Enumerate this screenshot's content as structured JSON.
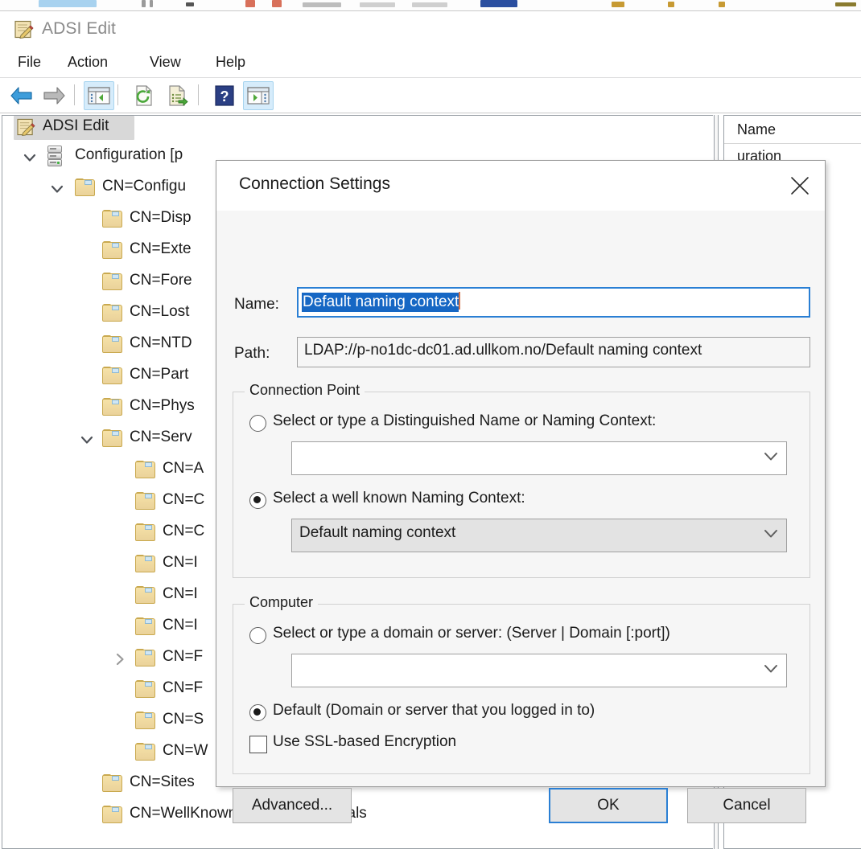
{
  "window": {
    "title": "ADSI Edit",
    "title_icon": "adsi-edit-icon",
    "menu": [
      {
        "label": "File"
      },
      {
        "label": "Action"
      },
      {
        "label": "View"
      },
      {
        "label": "Help"
      }
    ],
    "toolbar": [
      {
        "name": "back-icon",
        "active": false
      },
      {
        "name": "forward-icon",
        "active": false
      },
      {
        "name": "show-hide-console-tree-icon",
        "active": true
      },
      {
        "name": "refresh-icon",
        "active": false
      },
      {
        "name": "export-list-icon",
        "active": false
      },
      {
        "name": "help-icon",
        "active": false
      },
      {
        "name": "show-hide-action-pane-icon",
        "active": true
      }
    ]
  },
  "tree": {
    "root_label": "ADSI Edit",
    "root_icon": "adsi-edit-icon",
    "items": [
      {
        "label": "Configuration [p",
        "icon": "server-icon",
        "depth": 0,
        "expander": "expanded"
      },
      {
        "label": "CN=Configu",
        "icon": "folder-icon",
        "depth": 1,
        "expander": "expanded"
      },
      {
        "label": "CN=Disp",
        "icon": "folder-icon",
        "depth": 2,
        "expander": "none"
      },
      {
        "label": "CN=Exte",
        "icon": "folder-icon",
        "depth": 2,
        "expander": "none"
      },
      {
        "label": "CN=Fore",
        "icon": "folder-icon",
        "depth": 2,
        "expander": "none"
      },
      {
        "label": "CN=Lost",
        "icon": "folder-icon",
        "depth": 2,
        "expander": "none"
      },
      {
        "label": "CN=NTD",
        "icon": "folder-icon",
        "depth": 2,
        "expander": "none"
      },
      {
        "label": "CN=Part",
        "icon": "folder-icon",
        "depth": 2,
        "expander": "none"
      },
      {
        "label": "CN=Phys",
        "icon": "folder-icon",
        "depth": 2,
        "expander": "none"
      },
      {
        "label": "CN=Serv",
        "icon": "folder-icon",
        "depth": 2,
        "expander": "expanded"
      },
      {
        "label": "CN=A",
        "icon": "folder-icon",
        "depth": 3,
        "expander": "none"
      },
      {
        "label": "CN=C",
        "icon": "folder-icon",
        "depth": 3,
        "expander": "none"
      },
      {
        "label": "CN=C",
        "icon": "folder-icon",
        "depth": 3,
        "expander": "none"
      },
      {
        "label": "CN=I",
        "icon": "folder-icon",
        "depth": 3,
        "expander": "none"
      },
      {
        "label": "CN=I",
        "icon": "folder-icon",
        "depth": 3,
        "expander": "none"
      },
      {
        "label": "CN=I",
        "icon": "folder-icon",
        "depth": 3,
        "expander": "none"
      },
      {
        "label": "CN=F",
        "icon": "folder-icon",
        "depth": 3,
        "expander": "collapsed"
      },
      {
        "label": "CN=F",
        "icon": "folder-icon",
        "depth": 3,
        "expander": "none"
      },
      {
        "label": "CN=S",
        "icon": "folder-icon",
        "depth": 3,
        "expander": "none"
      },
      {
        "label": "CN=W",
        "icon": "folder-icon",
        "depth": 3,
        "expander": "none"
      },
      {
        "label": "CN=Sites",
        "icon": "folder-icon",
        "depth": 2,
        "expander": "none"
      },
      {
        "label": "CN=WellKnown Security Principals",
        "icon": "folder-icon",
        "depth": 2,
        "expander": "none"
      }
    ]
  },
  "right_pane": {
    "column_header": "Name",
    "rows": [
      {
        "name": "uration"
      }
    ]
  },
  "dialog": {
    "title": "Connection Settings",
    "close_icon": "close-icon",
    "name_label": "Name:",
    "name_value": "Default naming context",
    "path_label": "Path:",
    "path_value": "LDAP://p-no1dc-dc01.ad.ullkom.no/Default naming context",
    "connection_point": {
      "legend": "Connection Point",
      "option_dn_label": "Select or type a Distinguished Name or Naming Context:",
      "option_dn_selected": false,
      "dn_combo_value": "",
      "option_wellknown_label": "Select a well known Naming Context:",
      "option_wellknown_selected": true,
      "wellknown_combo_value": "Default naming context"
    },
    "computer": {
      "legend": "Computer",
      "option_server_label": "Select or type a domain or server: (Server | Domain [:port])",
      "option_server_selected": false,
      "server_combo_value": "",
      "option_default_label": "Default (Domain or server that you logged in to)",
      "option_default_selected": true,
      "ssl_checkbox_label": "Use SSL-based Encryption",
      "ssl_checked": false
    },
    "buttons": {
      "advanced": "Advanced...",
      "ok": "OK",
      "cancel": "Cancel"
    }
  },
  "colors": {
    "accent": "#2a7fd4",
    "selection": "#1667c4",
    "dialog_bg": "#f6f6f6",
    "toolbar_active": "#d6ecfb"
  }
}
